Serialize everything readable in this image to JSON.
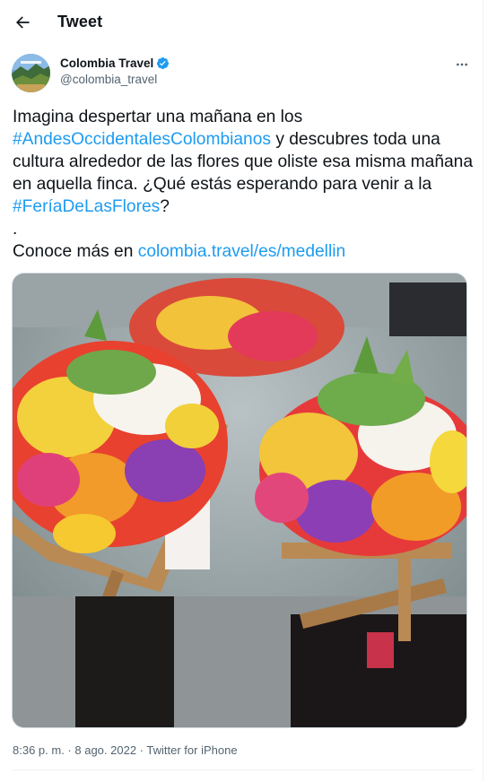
{
  "header": {
    "title": "Tweet"
  },
  "author": {
    "name": "Colombia Travel",
    "handle": "@colombia_travel",
    "verified": true
  },
  "tweet": {
    "line1": "Imagina despertar una mañana en los",
    "hashtag1": "#AndesOccidentalesColombianos",
    "after_hashtag1": " y descubres toda una cultura alrededor de las flores que oliste esa misma mañana en aquella finca. ¿Qué estás esperando para venir a  la ",
    "hashtag2": "#FeríaDeLasFlores",
    "after_hashtag2": "?",
    "dot": ".",
    "more_prefix": "Conoce más en ",
    "link": "colombia.travel/es/medellin"
  },
  "meta": {
    "time": "8:36 p. m.",
    "separator": " · ",
    "date": "8 ago. 2022",
    "source": "Twitter for iPhone"
  },
  "colors": {
    "link": "#1d9bf0",
    "verified": "#1d9bf0",
    "secondary_text": "#536471"
  },
  "icons": {
    "back": "arrow-left-icon",
    "more": "more-horizontal-icon",
    "verified": "verified-badge-icon"
  }
}
